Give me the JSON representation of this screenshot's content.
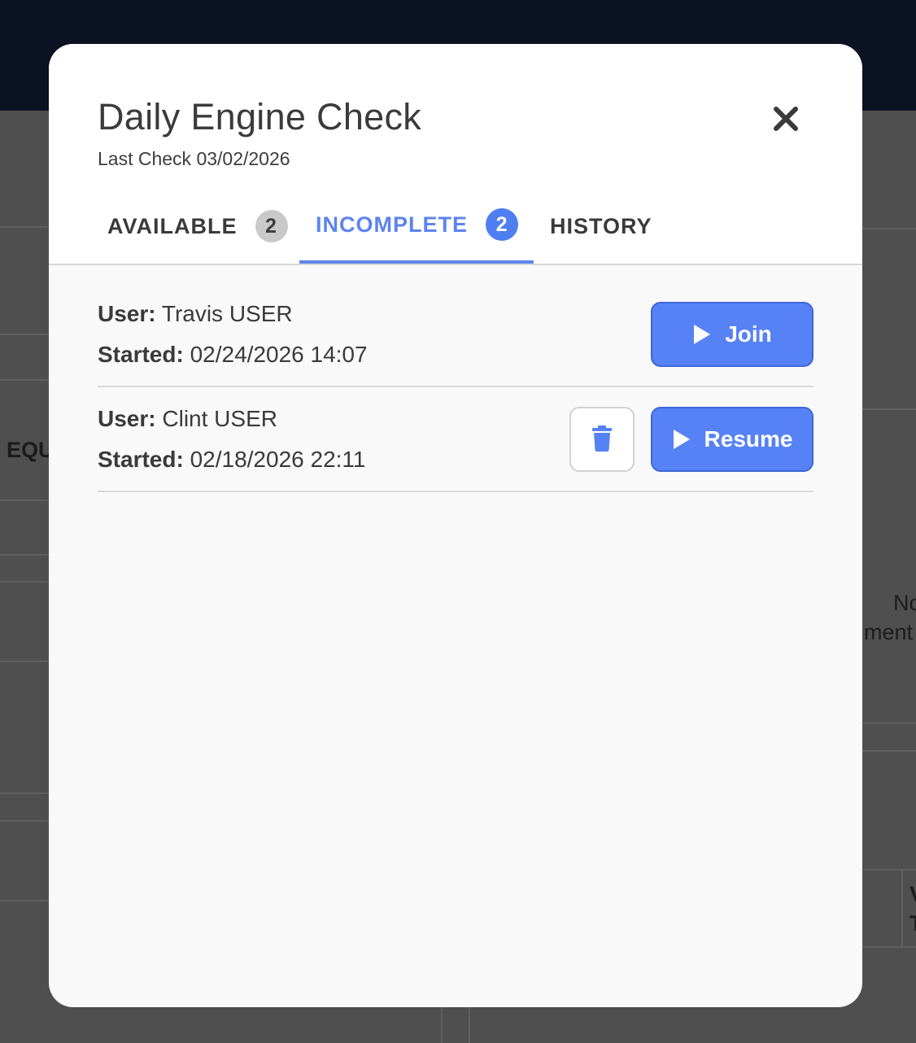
{
  "background": {
    "left_fragment": "EQU",
    "right_fragment_1": "No",
    "right_fragment_2": "ment",
    "right_fragment_3": "V",
    "right_fragment_4": "T"
  },
  "modal": {
    "title": "Daily Engine Check",
    "subtitle": "Last Check 03/02/2026",
    "close_icon": "close-icon",
    "tabs": [
      {
        "label": "AVAILABLE",
        "badge": "2",
        "active": false
      },
      {
        "label": "INCOMPLETE",
        "badge": "2",
        "active": true
      },
      {
        "label": "HISTORY",
        "active": false
      }
    ],
    "rows": [
      {
        "user_label": "User:",
        "user": "Travis USER",
        "started_label": "Started:",
        "started": "02/24/2026 14:07",
        "action_label": "Join",
        "action_icon": "play-icon",
        "deletable": false
      },
      {
        "user_label": "User:",
        "user": "Clint USER",
        "started_label": "Started:",
        "started": "02/18/2026 22:11",
        "action_label": "Resume",
        "action_icon": "play-icon",
        "delete_icon": "trash-icon",
        "deletable": true
      }
    ]
  },
  "colors": {
    "accent": "#5782f5",
    "active_tab": "#5d84ee",
    "topbar": "#0b1222",
    "overlay": "#4f4f4f"
  }
}
